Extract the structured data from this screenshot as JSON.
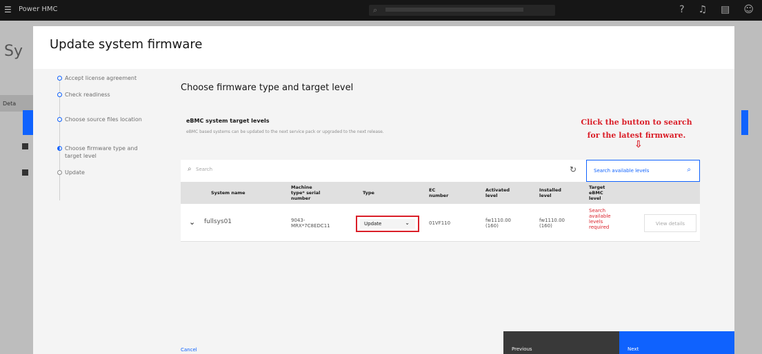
{
  "topbar": {
    "brand": "Power HMC",
    "search_placeholder": "Search",
    "icons": [
      "help-icon",
      "notification-icon",
      "tasks-icon",
      "user-icon"
    ]
  },
  "background": {
    "page_title": "Sy",
    "tab_label": "Deta"
  },
  "modal": {
    "title": "Update system firmware"
  },
  "steps": [
    {
      "label": "Accept license agreement",
      "state": "complete"
    },
    {
      "label": "Check readiness",
      "state": "complete"
    },
    {
      "label": "Choose source files location",
      "state": "complete"
    },
    {
      "label": "Choose firmware type and target level",
      "state": "current"
    },
    {
      "label": "Update",
      "state": "todo"
    }
  ],
  "content": {
    "title": "Choose firmware type and target level",
    "levels_title": "eBMC system target levels",
    "levels_description": "eBMC based systems can be updated to the next service pack or upgraded to the next release."
  },
  "annotation": {
    "line1": "Click the button to search",
    "line2": "for the latest firmware.",
    "arrow": "⇩",
    "color": "#da1e28"
  },
  "toolbar": {
    "search_placeholder": "Search",
    "search_levels_label": "Search available levels"
  },
  "table": {
    "columns": [
      "System name",
      "Machine type* serial number",
      "Type",
      "EC number",
      "Activated level",
      "Installed level",
      "Target eBMC level"
    ],
    "rows": [
      {
        "system_name": "fullsys01",
        "machine_type_serial": "9043-MRX*7C8EDC11",
        "type": "Update",
        "ec_number": "01VF110",
        "activated_level": "fw1110.00 (160)",
        "installed_level": "fw1110.00 (160)",
        "target_level": "Search available levels required",
        "action": "View details"
      }
    ]
  },
  "footer": {
    "cancel": "Cancel",
    "previous": "Previous",
    "next": "Next"
  },
  "colors": {
    "accent": "#0f62fe",
    "highlight": "#da1e28"
  }
}
